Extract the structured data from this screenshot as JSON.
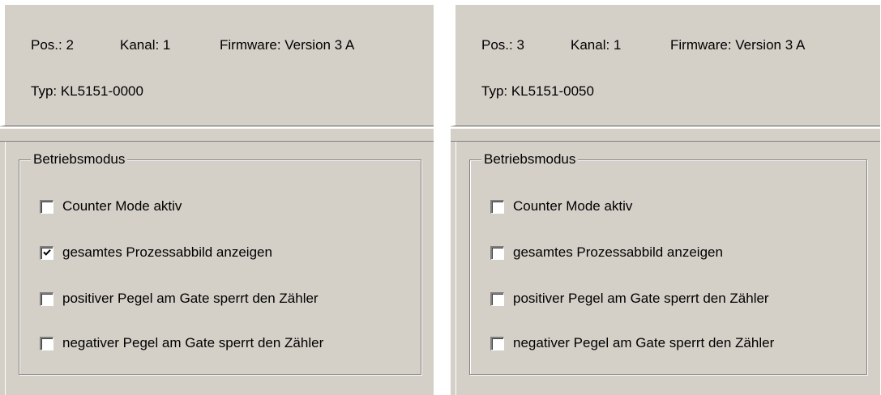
{
  "panels": [
    {
      "pos_label": "Pos.: 2",
      "kanal_label": "Kanal: 1",
      "firmware_label": "Firmware: Version 3 A",
      "typ_label": "Typ:  KL5151-0000",
      "group_title": "Betriebsmodus",
      "options": [
        {
          "label": "Counter Mode aktiv",
          "checked": false
        },
        {
          "label": "gesamtes Prozessabbild anzeigen",
          "checked": true
        },
        {
          "label": "positiver Pegel am Gate sperrt den Zähler",
          "checked": false
        },
        {
          "label": "negativer Pegel am Gate sperrt den Zähler",
          "checked": false
        }
      ]
    },
    {
      "pos_label": "Pos.: 3",
      "kanal_label": "Kanal: 1",
      "firmware_label": "Firmware: Version 3 A",
      "typ_label": "Typ:  KL5151-0050",
      "group_title": "Betriebsmodus",
      "options": [
        {
          "label": "Counter Mode aktiv",
          "checked": false
        },
        {
          "label": "gesamtes Prozessabbild anzeigen",
          "checked": false
        },
        {
          "label": "positiver Pegel am Gate sperrt den Zähler",
          "checked": false
        },
        {
          "label": "negativer Pegel am Gate sperrt den Zähler",
          "checked": false
        }
      ]
    }
  ],
  "colors": {
    "face": "#d4d0c8",
    "shadow": "#808080",
    "highlight": "#ffffff"
  }
}
